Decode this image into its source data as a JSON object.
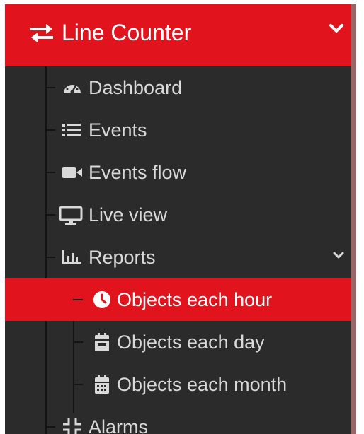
{
  "header": {
    "title": "Line Counter",
    "icon": "exchange-arrows-icon",
    "chevron": "chevron-down-icon"
  },
  "menu": {
    "dashboard": {
      "label": "Dashboard",
      "icon": "tachometer-icon"
    },
    "events": {
      "label": "Events",
      "icon": "list-icon"
    },
    "events_flow": {
      "label": "Events flow",
      "icon": "video-camera-icon"
    },
    "live_view": {
      "label": "Live view",
      "icon": "monitor-icon"
    },
    "reports": {
      "label": "Reports",
      "icon": "bar-chart-icon",
      "expanded": true,
      "items": [
        {
          "label": "Objects each hour",
          "icon": "clock-icon",
          "active": true
        },
        {
          "label": "Objects each day",
          "icon": "calendar-day-icon",
          "active": false
        },
        {
          "label": "Objects each month",
          "icon": "calendar-month-icon",
          "active": false
        }
      ]
    },
    "alarms": {
      "label": "Alarms",
      "icon": "compress-arrows-icon"
    }
  },
  "colors": {
    "accent": "#e1141e",
    "sidebar_bg": "#2b2b2b",
    "text": "#d9d9d9",
    "tree_line": "#141414"
  }
}
